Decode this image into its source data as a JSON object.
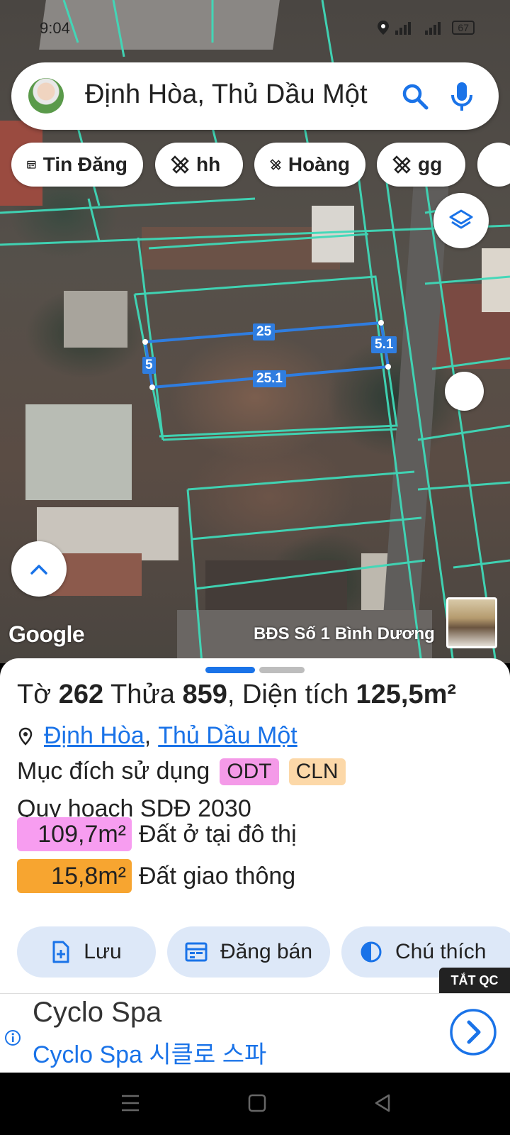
{
  "status_bar": {
    "time": "9:04",
    "battery": "67"
  },
  "search": {
    "query": "Định Hòa, Thủ Dầu Một"
  },
  "chips": [
    {
      "label": "Tin Đăng",
      "icon": "calendar-icon"
    },
    {
      "label": "hh",
      "icon": "ruler-pencil-icon"
    },
    {
      "label": "Hoàng",
      "icon": "ruler-pencil-icon"
    },
    {
      "label": "gg",
      "icon": "ruler-pencil-icon"
    }
  ],
  "map": {
    "measurements": {
      "top": "25",
      "right": "5.1",
      "bottom": "25.1",
      "left": "5"
    },
    "logo": "Google",
    "credit": "BĐS Số 1 Bình Dương"
  },
  "parcel": {
    "sheet_label": "Tờ",
    "sheet_no": "262",
    "plot_label": "Thửa",
    "plot_no": "859",
    "area_label": ", Diện tích",
    "area": "125,5m²",
    "ward": "Định Hòa",
    "district": "Thủ Dầu Một",
    "purpose_label": "Mục đích sử dụng",
    "purpose_tags": [
      {
        "code": "ODT",
        "color": "#f49ae8"
      },
      {
        "code": "CLN",
        "color": "#fcd8a8"
      }
    ],
    "plan_label": "Quy hoạch SDĐ 2030",
    "land_uses": [
      {
        "area": "109,7m²",
        "label": "Đất ở tại đô thị",
        "color": "#f79df0"
      },
      {
        "area": "15,8m²",
        "label": "Đất giao thông",
        "color": "#f7a530"
      }
    ]
  },
  "actions": [
    {
      "label": "Lưu",
      "icon": "save-file-icon"
    },
    {
      "label": "Đăng bán",
      "icon": "calendar-icon"
    },
    {
      "label": "Chú thích",
      "icon": "contrast-icon"
    }
  ],
  "ad_toggle": "TẮT QC",
  "ad": {
    "title": "Cyclo Spa",
    "subtitle": "Cyclo Spa 시클로 스파"
  },
  "colors": {
    "accent": "#1a73e8",
    "parcel_line": "#2f7de0",
    "cadastral": "#3fd9b8"
  }
}
